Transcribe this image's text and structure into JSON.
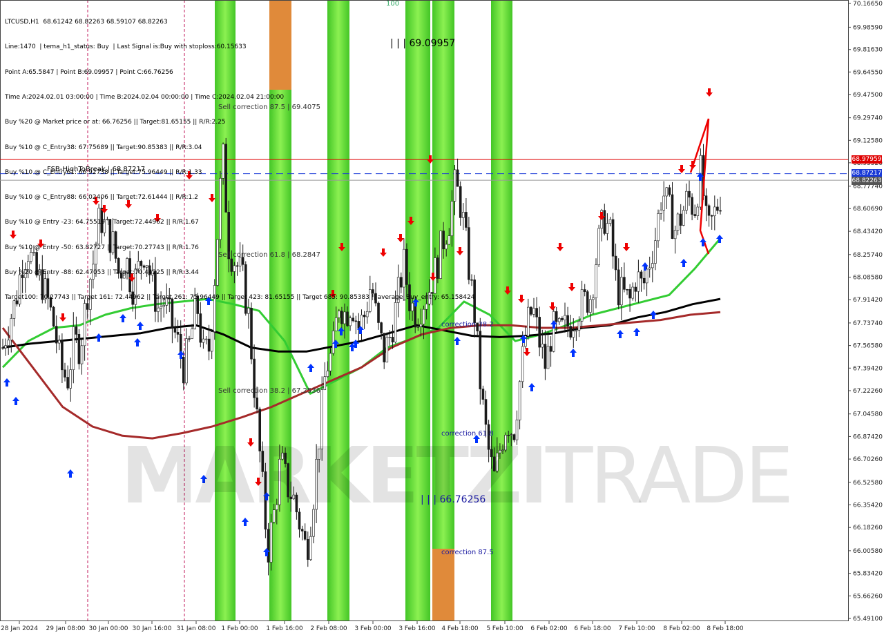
{
  "header": {
    "lines": [
      "LTCUSD,H1  68.61242 68.82263 68.59107 68.82263",
      "Line:1470  | tema_h1_status: Buy  | Last Signal is:Buy with stoploss:60.15633",
      "Point A:65.5847 | Point B:69.09957 | Point C:66.76256",
      "Time A:2024.02.01 03:00:00 | Time B:2024.02.04 00:00:00 | Time C:2024.02.04 21:00:00",
      "Buy %20 @ Market price or at: 66.76256 || Target:81.65155 || R/R:2.25",
      "Buy %10 @ C_Entry38: 67.75689 || Target:90.85383 || R/R:3.04",
      "Buy %10 @ C_Entry61: 66.92738 || Target:75.96449 || R/R:1.33",
      "Buy %10 @ C_Entry88: 66.02406 || Target:72.61444 || R/R:1.2",
      "Buy %10 @ Entry -23: 64.75519 || Target:72.44962 || R/R:1.67",
      "Buy %10 @ Entry -50: 63.82727 || Target:70.27743 || R/R:1.76",
      "Buy %20 @ Entry -88: 62.47053 || Target:70.44225 || R/R:3.44",
      "Target100: 70.27743 || Target 161: 72.44962 || Target 261: 75.96449 || Target 423: 81.65155 || Target 685: 90.85383 || average_Buy_entry: 65.158424"
    ]
  },
  "annotations": {
    "fsb": "FSB-HighToBreak  | 68.87217",
    "sell875": "Sell correction 87.5 | 69.4075",
    "sell618": "Sell correction 61.8 | 68.2847",
    "sell382": "Sell correction 38.2 | 67.2536",
    "corr382": "correction 38.2",
    "corr618": "correction 61.8",
    "corr875": "correction 87.5",
    "pointB": "| | | 69.09957",
    "pointC": "| | | 66.76256",
    "top100": "100"
  },
  "watermark": {
    "bold": "MARKETZI",
    "thin": "TRADE"
  },
  "price_tags": {
    "red": "68.97959",
    "blue": "68.87217",
    "gray": "68.82263"
  },
  "colors": {
    "bull": "#00aa00",
    "bear": "#d00000",
    "green_zone": "#33cc00",
    "orange_zone": "#e08a3a",
    "ema_fast": "#33cc33",
    "ema_mid": "#000000",
    "ema_slow": "#a52a2a",
    "blue_arrow": "#0033ff",
    "red_arrow": "#ee0000"
  },
  "chart_data": {
    "type": "candlestick",
    "symbol": "LTCUSD",
    "timeframe": "H1",
    "ylim": [
      65.491,
      70.1665
    ],
    "y_ticks": [
      "70.16650",
      "69.98590",
      "69.81630",
      "69.64550",
      "69.47500",
      "69.29740",
      "69.12580",
      "68.95520",
      "68.77740",
      "68.60690",
      "68.43420",
      "68.25740",
      "68.08580",
      "67.91420",
      "67.73740",
      "67.56580",
      "67.39420",
      "67.22260",
      "67.04580",
      "66.87420",
      "66.70260",
      "66.52580",
      "66.35420",
      "66.18260",
      "66.00580",
      "65.83420",
      "65.66260",
      "65.49100"
    ],
    "x_ticks": [
      "28 Jan 2024",
      "29 Jan 08:00",
      "30 Jan 00:00",
      "30 Jan 16:00",
      "31 Jan 08:00",
      "1 Feb 00:00",
      "1 Feb 16:00",
      "2 Feb 08:00",
      "3 Feb 00:00",
      "3 Feb 16:00",
      "4 Feb 18:00",
      "5 Feb 10:00",
      "6 Feb 02:00",
      "6 Feb 18:00",
      "7 Feb 10:00",
      "8 Feb 02:00",
      "8 Feb 18:00"
    ],
    "levels": {
      "red_line": 68.97959,
      "fsb_high_to_break": 68.87217,
      "current_price": 68.82263
    },
    "ohlc_last": {
      "open": 68.61242,
      "high": 68.82263,
      "low": 68.59107,
      "close": 68.82263
    },
    "price_path": [
      67.55,
      67.75,
      67.9,
      68.2,
      68.3,
      68.1,
      68.05,
      67.9,
      67.7,
      67.4,
      67.3,
      67.6,
      67.55,
      67.95,
      68.2,
      68.55,
      68.45,
      68.35,
      68.1,
      68.25,
      68.0,
      68.15,
      68.3,
      68.05,
      67.85,
      67.9,
      67.75,
      67.6,
      67.4,
      67.6,
      67.9,
      67.5,
      67.55,
      68.25,
      69.05,
      68.3,
      68.2,
      68.1,
      67.8,
      67.2,
      66.6,
      66.0,
      66.3,
      66.7,
      66.5,
      66.4,
      66.2,
      66.0,
      66.4,
      66.9,
      67.4,
      67.5,
      67.9,
      67.8,
      67.9,
      67.7,
      67.8,
      68.05,
      67.7,
      67.5,
      67.65,
      67.9,
      68.2,
      67.9,
      67.8,
      67.9,
      68.0,
      68.15,
      68.35,
      68.5,
      68.8,
      68.6,
      68.2,
      67.8,
      67.2,
      66.8,
      66.55,
      66.8,
      67.0,
      66.9,
      67.3,
      67.7,
      67.85,
      67.6,
      67.4,
      67.7,
      67.65,
      67.7,
      67.75,
      67.85,
      67.9,
      67.95,
      68.3,
      68.55,
      68.4,
      68.0,
      67.95,
      67.9,
      68.1,
      68.0,
      68.2,
      68.4,
      68.75,
      68.6,
      68.45,
      68.55,
      68.7,
      68.6,
      68.9,
      68.4,
      68.55,
      68.7
    ],
    "signals": {
      "buy_arrow_count": 38,
      "sell_arrow_count": 30
    },
    "moving_averages": [
      {
        "color": "green",
        "values": [
          67.4,
          67.6,
          67.7,
          67.72,
          67.8,
          67.85,
          67.88,
          67.9,
          67.92,
          67.88,
          67.83,
          67.6,
          67.2,
          67.3,
          67.4,
          67.55,
          67.62,
          67.7,
          67.9,
          67.8,
          67.6,
          67.65,
          67.72,
          67.8,
          67.85,
          67.9,
          67.95,
          68.15,
          68.38
        ]
      },
      {
        "color": "black",
        "values": [
          67.55,
          67.58,
          67.6,
          67.62,
          67.64,
          67.66,
          67.7,
          67.72,
          67.65,
          67.55,
          67.52,
          67.52,
          67.56,
          67.6,
          67.66,
          67.72,
          67.68,
          67.64,
          67.63,
          67.64,
          67.66,
          67.7,
          67.72,
          67.78,
          67.82,
          67.88,
          67.92
        ]
      },
      {
        "color": "brown",
        "values": [
          67.7,
          67.4,
          67.1,
          66.95,
          66.88,
          66.86,
          66.9,
          66.95,
          67.02,
          67.1,
          67.2,
          67.3,
          67.4,
          67.55,
          67.65,
          67.7,
          67.72,
          67.72,
          67.7,
          67.7,
          67.72,
          67.74,
          67.76,
          67.8,
          67.82
        ]
      }
    ]
  }
}
